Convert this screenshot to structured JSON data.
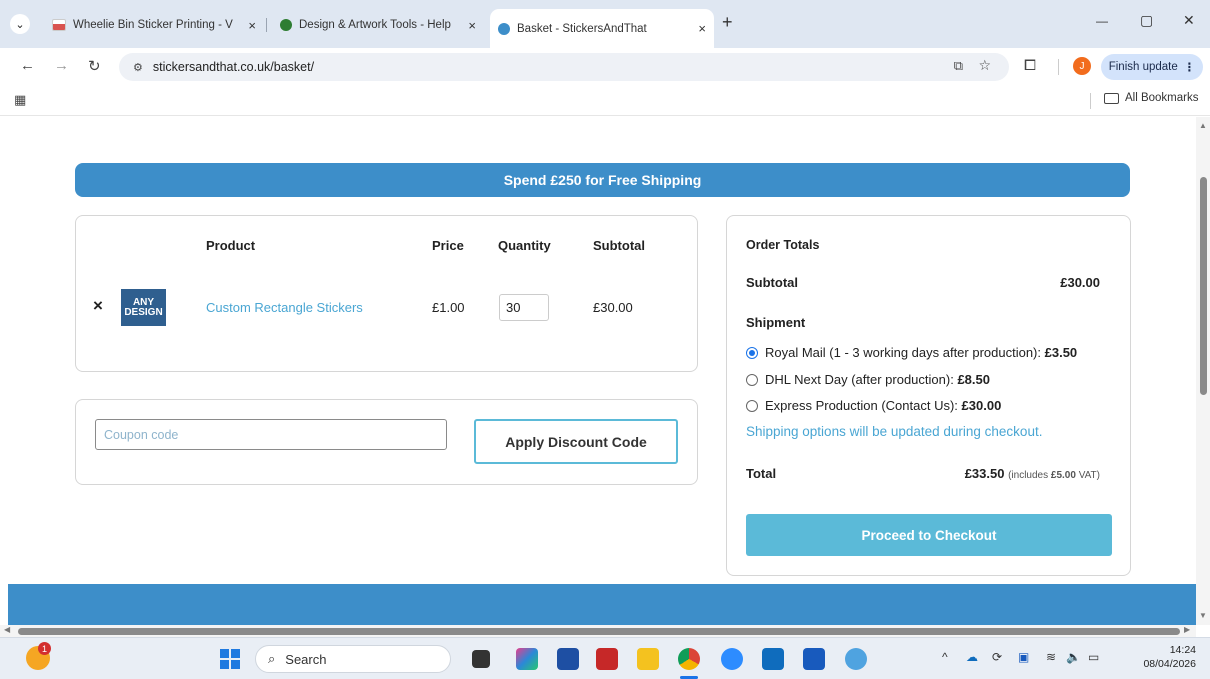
{
  "browser": {
    "tabs": [
      {
        "label": "Wheelie Bin Sticker Printing - V",
        "close": "×",
        "favicon_color": "#d9534f"
      },
      {
        "label": "Design & Artwork Tools - Help",
        "close": "×",
        "favicon_color": "#2e7d32"
      },
      {
        "label": "Basket - StickersAndThat",
        "close": "×",
        "favicon_color": "#3d8ec9"
      }
    ],
    "new_tab": "+",
    "tab_search": "⌄",
    "window_controls": {
      "minimize": "—",
      "restore": "▢",
      "close": "✕"
    },
    "url": "stickersandthat.co.uk/basket/",
    "finish_update": "Finish update",
    "profile_initial": "J",
    "all_bookmarks": "All Bookmarks"
  },
  "page": {
    "banner": "Spend £250 for Free Shipping",
    "cart": {
      "headers": {
        "product": "Product",
        "price": "Price",
        "quantity": "Quantity",
        "subtotal": "Subtotal"
      },
      "row": {
        "remove": "×",
        "thumb_text_1": "ANY",
        "thumb_text_2": "DESIGN",
        "product": "Custom Rectangle Stickers",
        "price": "£1.00",
        "quantity": "30",
        "subtotal": "£30.00"
      }
    },
    "coupon": {
      "placeholder": "Coupon code",
      "apply_label": "Apply Discount Code"
    },
    "totals": {
      "heading": "Order Totals",
      "subtotal_label": "Subtotal",
      "subtotal_value": "£30.00",
      "shipment_label": "Shipment",
      "options": [
        {
          "text": "Royal Mail (1 - 3 working days after production): ",
          "price": "£3.50",
          "selected": true
        },
        {
          "text": "DHL Next Day (after production): ",
          "price": "£8.50",
          "selected": false
        },
        {
          "text": "Express Production (Contact Us): ",
          "price": "£30.00",
          "selected": false
        }
      ],
      "shipping_note": "Shipping options will be updated during checkout.",
      "total_label": "Total",
      "total_value": "£33.50",
      "vat_prefix": "(includes ",
      "vat_amount": "£5.00",
      "vat_suffix": " VAT)",
      "checkout_label": "Proceed to Checkout"
    }
  },
  "taskbar": {
    "search_label": "Search",
    "notification_count": "1",
    "time": "14:24",
    "date": "08/04/2026"
  },
  "colors": {
    "brand_blue": "#3d8ec9",
    "accent_cyan": "#5bbad8",
    "link": "#4aa6d3"
  }
}
